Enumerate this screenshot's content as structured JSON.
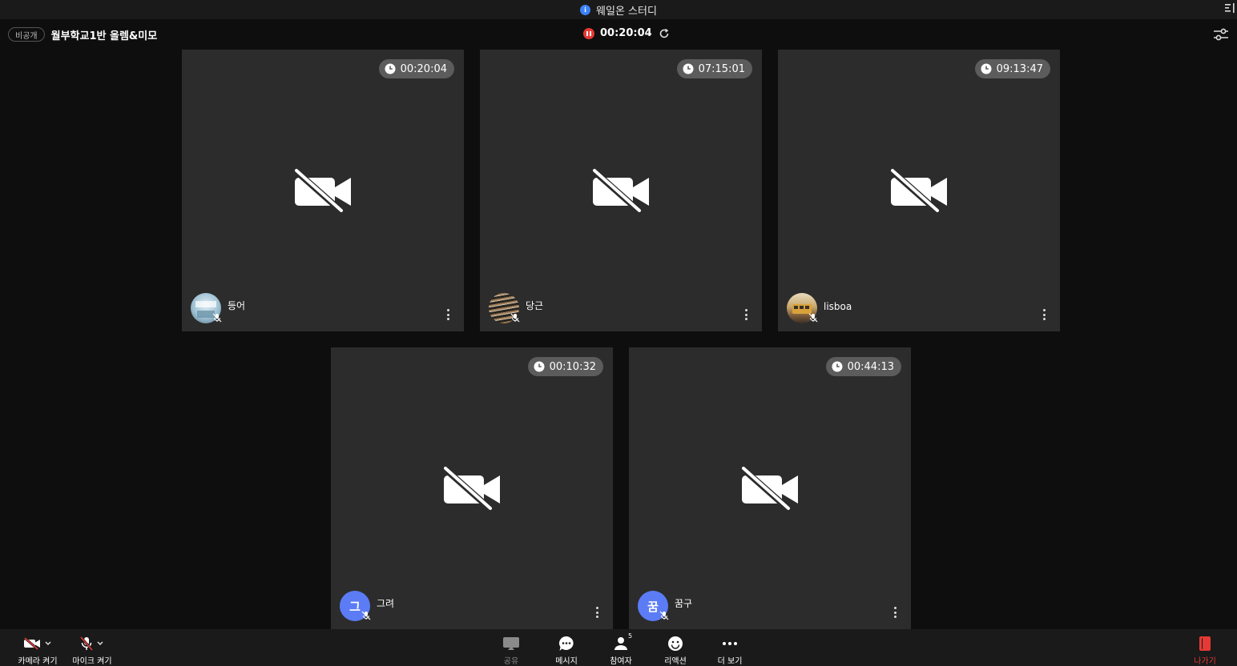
{
  "window": {
    "title": "웨일온 스터디"
  },
  "room": {
    "visibility_badge": "비공개",
    "title": "월부학교1반 올렘&미모",
    "recording_time": "00:20:04"
  },
  "participants": [
    {
      "name": "등어",
      "timer": "00:20:04",
      "avatar_type": "photo",
      "avatar_colors": [
        "#cfe0ea",
        "#6a8ea3"
      ]
    },
    {
      "name": "당근",
      "timer": "07:15:01",
      "avatar_type": "photo",
      "avatar_colors": [
        "#8a6a4a",
        "#2a2a2a"
      ]
    },
    {
      "name": "lisboa",
      "timer": "09:13:47",
      "avatar_type": "photo",
      "avatar_colors": [
        "#c9a86a",
        "#5a4a3a"
      ]
    },
    {
      "name": "그려",
      "timer": "00:10:32",
      "avatar_type": "initial",
      "initial": "그"
    },
    {
      "name": "꿈구",
      "timer": "00:44:13",
      "avatar_type": "initial",
      "initial": "꿈"
    }
  ],
  "toolbar": {
    "camera_label": "카메라 켜기",
    "mic_label": "마이크 켜기",
    "share_label": "공유",
    "message_label": "메시지",
    "participants_label": "참여자",
    "participants_count": "5",
    "reaction_label": "리액션",
    "more_label": "더 보기",
    "exit_label": "나가기"
  },
  "colors": {
    "background": "#0e0e0e",
    "tile": "#2c2c2c",
    "timer_pill": "#5c5c5c",
    "initial_avatar": "#5b7cf5",
    "record_red": "#e53935",
    "exit_red": "#e53935"
  },
  "icons": {
    "tile_center": "camera-off-icon",
    "timer": "clock-icon",
    "title_info": "info-icon",
    "settings": "sliders-icon"
  }
}
